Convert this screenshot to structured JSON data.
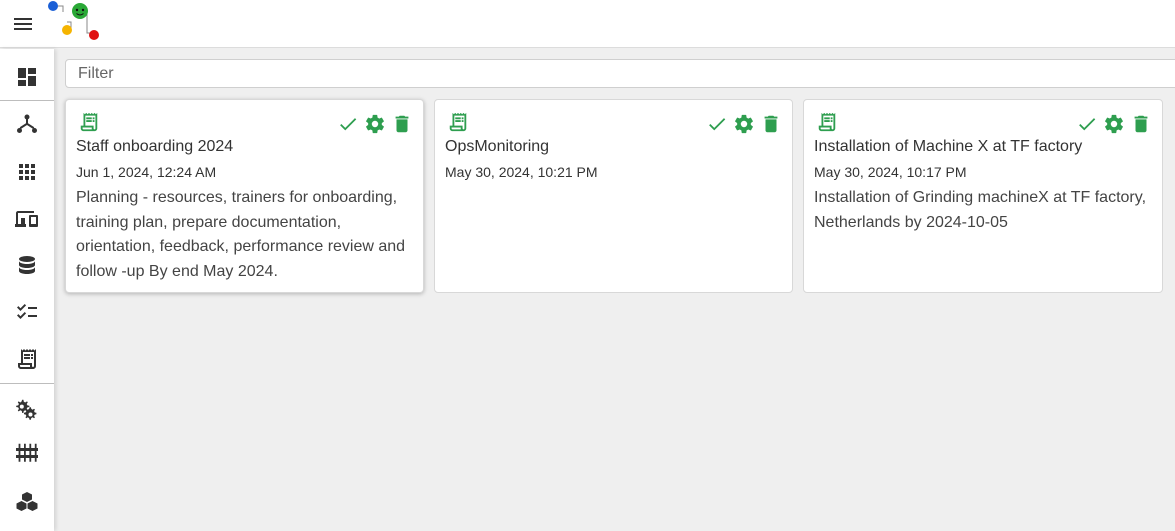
{
  "topbar": {
    "menu_icon": "hamburger-menu-icon",
    "logo_icon": "app-logo-icon"
  },
  "sidebar": {
    "items": [
      {
        "icon": "dashboard-icon"
      },
      {
        "icon": "hub-icon"
      },
      {
        "icon": "apps-grid-icon"
      },
      {
        "icon": "devices-icon"
      },
      {
        "icon": "database-icon"
      },
      {
        "icon": "checklist-icon"
      },
      {
        "icon": "receipt-icon"
      },
      {
        "icon": "settings-gears-icon"
      },
      {
        "icon": "tune-sliders-icon"
      },
      {
        "icon": "cubes-icon"
      }
    ]
  },
  "filter": {
    "placeholder": "Filter",
    "value": ""
  },
  "cards": [
    {
      "title": "Staff onboarding 2024",
      "date": "Jun 1, 2024, 12:24 AM",
      "description": "Planning - resources, trainers for onboarding, training plan, prepare documentation, orientation, feedback, performance review and follow -up By end May 2024."
    },
    {
      "title": "OpsMonitoring",
      "date": "May 30, 2024, 10:21 PM",
      "description": ""
    },
    {
      "title": "Installation of Machine X at TF factory",
      "date": "May 30, 2024, 10:17 PM",
      "description": "Installation of Grinding machineX at TF factory, Netherlands by 2024-10-05"
    }
  ],
  "colors": {
    "accent": "#2e9e4f",
    "logo_blue": "#1a5fd6",
    "logo_green": "#2aa836",
    "logo_yellow": "#f5b400",
    "logo_red": "#e01010"
  }
}
